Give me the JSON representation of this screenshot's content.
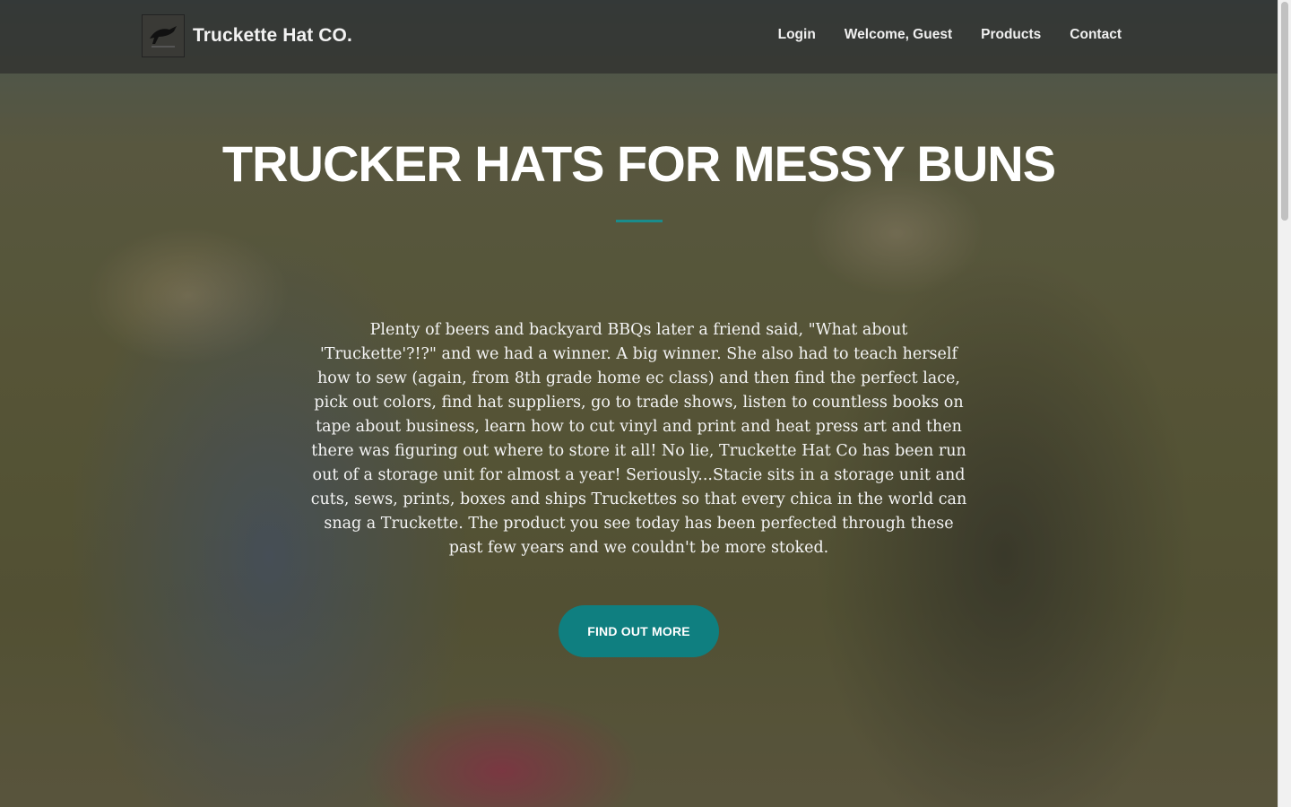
{
  "brand": {
    "name": "Truckette Hat CO.",
    "logo_icon": "truckette-logo-icon"
  },
  "nav": {
    "items": [
      {
        "label": "Login"
      },
      {
        "label": "Welcome, Guest"
      },
      {
        "label": "Products"
      },
      {
        "label": "Contact"
      }
    ]
  },
  "hero": {
    "headline": "TRUCKER HATS FOR MESSY BUNS",
    "body": "Plenty of beers and backyard BBQs later a friend said, \"What about 'Truckette'?!?\" and we had a winner. A big winner. She also had to teach herself how to sew (again, from 8th grade home ec class) and then find the perfect lace, pick out colors, find hat suppliers, go to trade shows, listen to countless books on tape about business, learn how to cut vinyl and print and heat press art and then there was figuring out where to store it all! No lie, Truckette Hat Co has been run out of a storage unit for almost a year! Seriously...Stacie sits in a storage unit and cuts, sews, prints, boxes and ships Truckettes so that every chica in the world can snag a Truckette. The product you see today has been perfected through these past few years and we couldn't be more stoked.",
    "cta_label": "FIND OUT MORE"
  },
  "colors": {
    "accent": "#0f7f80",
    "divider": "#1a8c8c",
    "navbar": "rgba(40,40,40,0.62)"
  }
}
